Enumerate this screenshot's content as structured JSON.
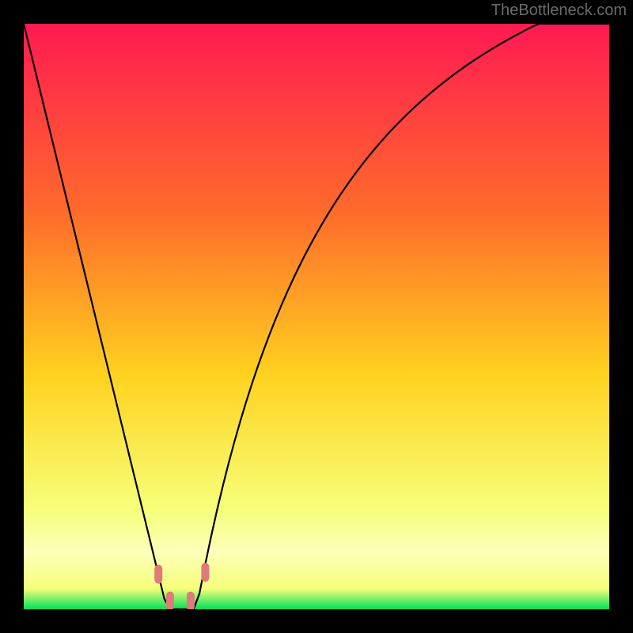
{
  "watermark": "TheBottleneck.com",
  "colors": {
    "background_frame": "#000000",
    "gradient_top": "#ff1a52",
    "gradient_upper_mid": "#ff6a2b",
    "gradient_mid": "#ffd21f",
    "gradient_lower_mid": "#f6ff7a",
    "gradient_pale_band": "#fdffb8",
    "gradient_bottom": "#00e05a",
    "curve": "#000000",
    "marker_fill": "#e07a7a",
    "marker_stroke": "#c95c5c"
  },
  "chart_data": {
    "type": "line",
    "title": "",
    "xlabel": "",
    "ylabel": "",
    "xlim": [
      0,
      100
    ],
    "ylim": [
      0,
      100
    ],
    "x": [
      0,
      1,
      2,
      3,
      4,
      5,
      6,
      7,
      8,
      9,
      10,
      11,
      12,
      13,
      14,
      15,
      16,
      17,
      18,
      19,
      20,
      21,
      22,
      23,
      24,
      25,
      26,
      27,
      28,
      29,
      30,
      31,
      32,
      33,
      34,
      35,
      36,
      37,
      38,
      39,
      40,
      41,
      42,
      43,
      44,
      45,
      46,
      47,
      48,
      49,
      50,
      51,
      52,
      53,
      54,
      55,
      56,
      57,
      58,
      59,
      60,
      61,
      62,
      63,
      64,
      65,
      66,
      67,
      68,
      69,
      70,
      71,
      72,
      73,
      74,
      75,
      76,
      77,
      78,
      79,
      80,
      81,
      82,
      83,
      84,
      85,
      86,
      87,
      88,
      89,
      90,
      91,
      92,
      93,
      94,
      95,
      96,
      97,
      98,
      99,
      100
    ],
    "series": [
      {
        "name": "bottleneck-curve",
        "values": [
          100.0,
          95.91,
          91.82,
          87.73,
          83.64,
          79.55,
          75.45,
          71.36,
          67.27,
          63.18,
          59.09,
          55.0,
          50.91,
          46.82,
          42.73,
          38.64,
          34.55,
          30.45,
          26.36,
          22.27,
          18.18,
          14.09,
          10.0,
          5.91,
          1.82,
          0.0,
          0.0,
          0.0,
          0.0,
          0.0,
          2.66,
          7.69,
          12.42,
          16.87,
          21.05,
          24.98,
          28.68,
          32.17,
          35.47,
          38.59,
          41.54,
          44.33,
          46.99,
          49.51,
          51.91,
          54.19,
          56.37,
          58.45,
          60.44,
          62.34,
          64.15,
          65.89,
          67.56,
          69.15,
          70.69,
          72.15,
          73.56,
          74.92,
          76.22,
          77.47,
          78.68,
          79.84,
          80.96,
          82.04,
          83.08,
          84.08,
          85.05,
          85.98,
          86.89,
          87.76,
          88.6,
          89.42,
          90.21,
          90.98,
          91.72,
          92.44,
          93.13,
          93.81,
          94.46,
          95.1,
          95.71,
          96.31,
          96.89,
          97.46,
          98.0,
          98.54,
          99.06,
          99.56,
          100.05,
          100.53,
          101.0,
          101.45,
          101.89,
          102.32,
          102.74,
          103.15,
          103.55,
          103.94,
          104.32,
          104.69,
          105.05
        ]
      }
    ],
    "markers": [
      {
        "name": "left-descending-marker",
        "x": 23.0,
        "y": 6.0
      },
      {
        "name": "left-bottom-marker",
        "x": 25.0,
        "y": 1.4
      },
      {
        "name": "right-bottom-marker",
        "x": 28.5,
        "y": 1.4
      },
      {
        "name": "right-ascending-marker",
        "x": 31.0,
        "y": 6.3
      }
    ],
    "gradient_stops": [
      {
        "offset": 0.0,
        "color_key": "gradient_top"
      },
      {
        "offset": 0.32,
        "color_key": "gradient_upper_mid"
      },
      {
        "offset": 0.6,
        "color_key": "gradient_mid"
      },
      {
        "offset": 0.83,
        "color_key": "gradient_lower_mid"
      },
      {
        "offset": 0.9,
        "color_key": "gradient_pale_band"
      },
      {
        "offset": 0.965,
        "color_key": "gradient_lower_mid"
      },
      {
        "offset": 1.0,
        "color_key": "gradient_bottom"
      }
    ]
  }
}
